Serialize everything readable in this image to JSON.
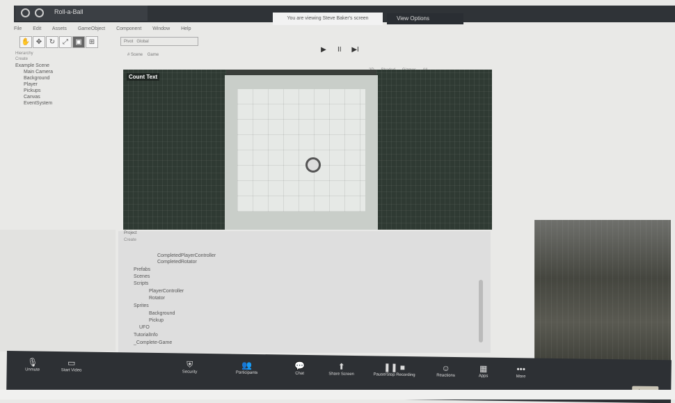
{
  "window": {
    "title": "Roll-a-Ball",
    "sharing_notice": "You are viewing Steve Baker's screen",
    "view_options": "View Options"
  },
  "menu": [
    "File",
    "Edit",
    "Assets",
    "GameObject",
    "Component",
    "Window",
    "Help"
  ],
  "toolbar": {
    "tools": [
      "hand-tool",
      "move-tool",
      "rotate-tool",
      "scale-tool",
      "rect-tool",
      "transform-tool"
    ],
    "pivot_label": "Pivot",
    "global_label": "Global"
  },
  "playback": {
    "play": "▶",
    "pause": "II",
    "step": "▶I"
  },
  "hierarchy": {
    "header": "Hierarchy",
    "create": "Create",
    "scene": "Example Scene",
    "items": [
      "Main Camera",
      "Background",
      "Player",
      "Pickups",
      "Canvas",
      "EventSystem"
    ]
  },
  "scene_tabs": {
    "scene": "# Scene",
    "game": "Game"
  },
  "scene_toolbar": [
    "2D",
    "Shaded",
    "Gizmos",
    "All"
  ],
  "viewport": {
    "count_text": "Count Text"
  },
  "project": {
    "header": "Project",
    "create": "Create",
    "rows": [
      "CompletedPlayerController",
      "CompletedRotator",
      "Prefabs",
      "Scenes",
      "Scripts",
      "PlayerController",
      "Rotator",
      "Sprites",
      "Background",
      "Pickup",
      "UFO",
      "TutorialInfo",
      "_Complete-Game"
    ]
  },
  "zoom_controls": [
    {
      "label": "Unmute",
      "icon": "microphone-icon"
    },
    {
      "label": "Start Video",
      "icon": "camera-icon"
    },
    {
      "label": "Security",
      "icon": "shield-icon"
    },
    {
      "label": "Participants",
      "icon": "people-icon"
    },
    {
      "label": "Chat",
      "icon": "chat-icon"
    },
    {
      "label": "Share Screen",
      "icon": "share-icon"
    },
    {
      "label": "Pause/Stop Recording",
      "icon": "record-icon"
    },
    {
      "label": "Reactions",
      "icon": "smile-icon"
    },
    {
      "label": "Apps",
      "icon": "apps-icon"
    },
    {
      "label": "More",
      "icon": "more-icon"
    }
  ],
  "leave_label": "Leave"
}
